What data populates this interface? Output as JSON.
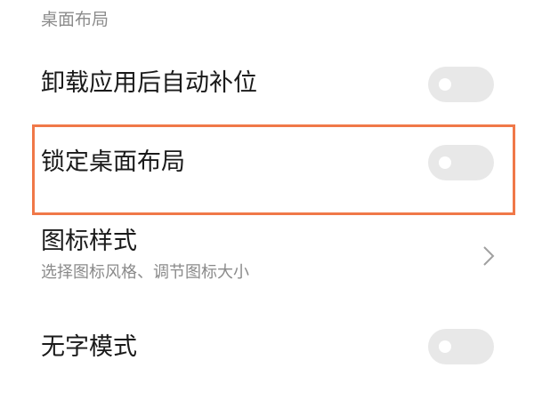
{
  "section": {
    "title": "桌面布局"
  },
  "settings": {
    "auto_fill": {
      "label": "卸载应用后自动补位",
      "enabled": false
    },
    "lock_layout": {
      "label": "锁定桌面布局",
      "enabled": false
    },
    "icon_style": {
      "label": "图标样式",
      "description": "选择图标风格、调节图标大小",
      "icon": "chevron-right-icon"
    },
    "no_text_mode": {
      "label": "无字模式",
      "enabled": false
    }
  },
  "colors": {
    "highlight": "#f07848",
    "toggle_off": "#e8e8e8",
    "text_primary": "#1a1a1a",
    "text_secondary": "#8a8a8a"
  }
}
